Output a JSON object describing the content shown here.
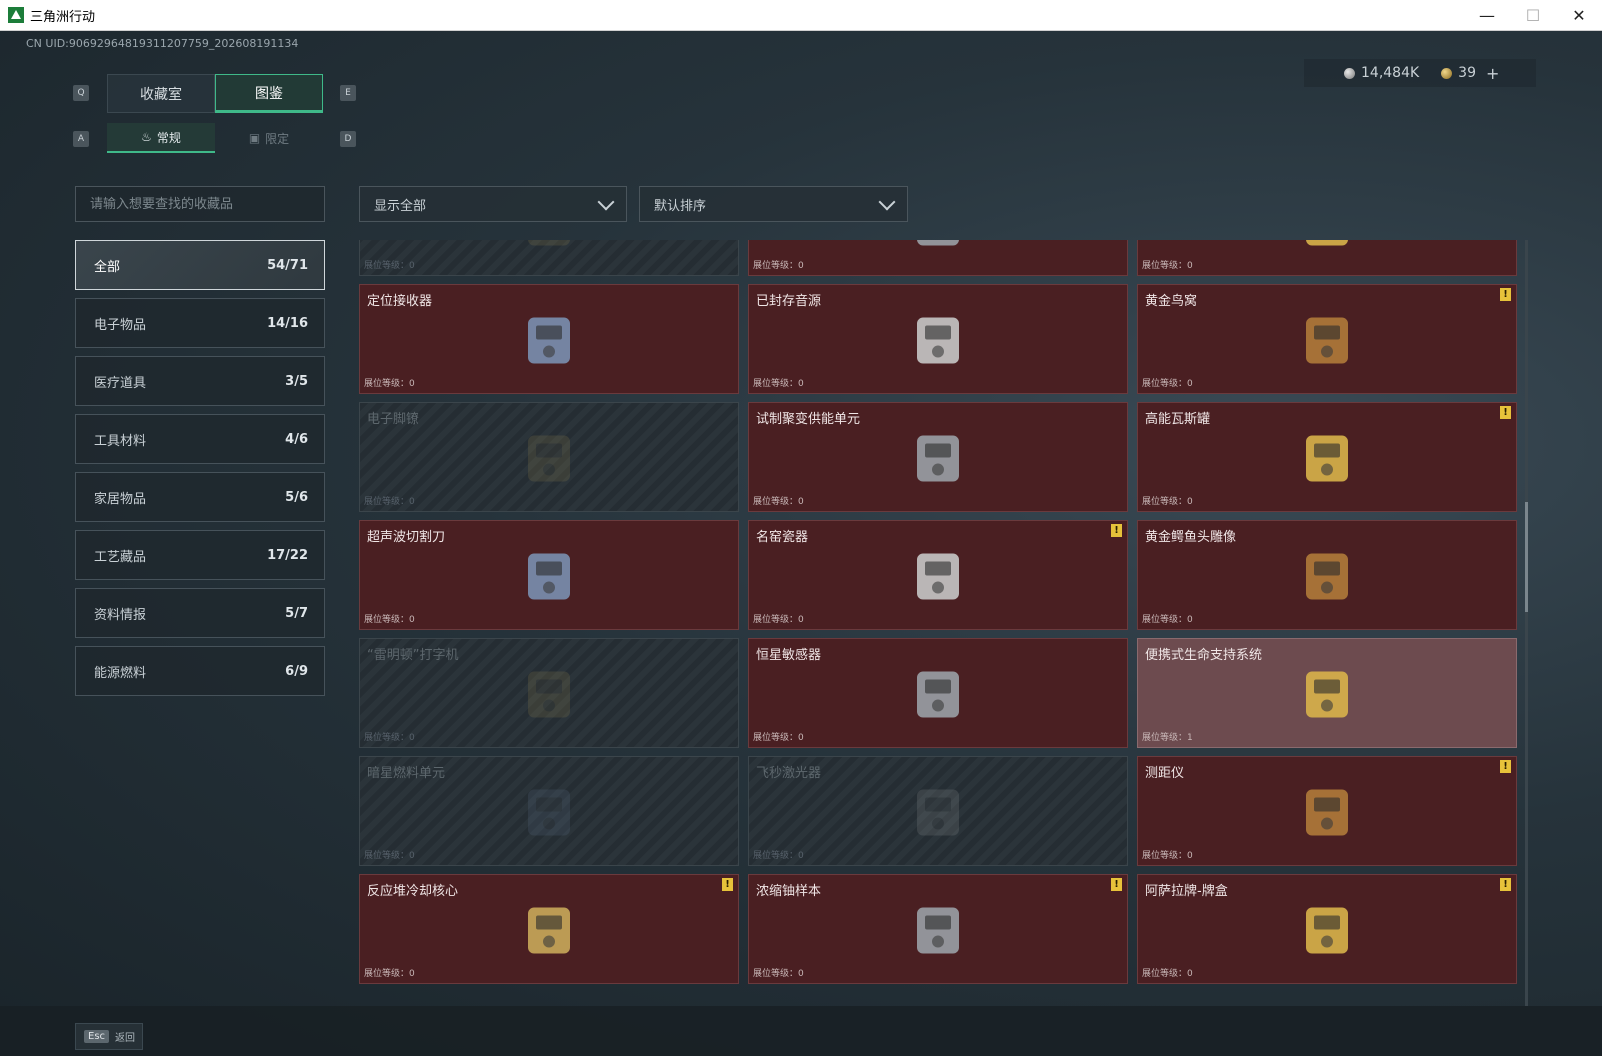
{
  "window": {
    "title": "三角洲行动"
  },
  "uid": "CN UID:9069296481931120775​9_202608191134",
  "main_tabs": [
    {
      "label": "收藏室",
      "active": false
    },
    {
      "label": "图鉴",
      "active": true
    }
  ],
  "sub_tabs": [
    {
      "label": "常规",
      "active": true
    },
    {
      "label": "限定",
      "active": false
    }
  ],
  "key_hints": {
    "prev_main": "Q",
    "next_main": "E",
    "prev_sub": "A",
    "next_sub": "D"
  },
  "currency": {
    "silver": "14,484K",
    "gold": "39",
    "add": "+"
  },
  "search": {
    "placeholder": "请输入想要查找的收藏品"
  },
  "filters": {
    "display": "显示全部",
    "sort": "默认排序"
  },
  "categories": [
    {
      "label": "全部",
      "count": "54/71",
      "active": true
    },
    {
      "label": "电子物品",
      "count": "14/16"
    },
    {
      "label": "医疗道具",
      "count": "3/5"
    },
    {
      "label": "工具材料",
      "count": "4/6"
    },
    {
      "label": "家居物品",
      "count": "5/6"
    },
    {
      "label": "工艺藏品",
      "count": "17/22"
    },
    {
      "label": "资料情报",
      "count": "5/7"
    },
    {
      "label": "能源燃料",
      "count": "6/9"
    }
  ],
  "level_label": "展位等级：",
  "items": [
    {
      "name": "",
      "level": "0",
      "state": "locked",
      "icon": "device-icon"
    },
    {
      "name": "",
      "level": "0",
      "state": "owned",
      "icon": "map-icon"
    },
    {
      "name": "",
      "level": "0",
      "state": "owned",
      "icon": "painting-icon"
    },
    {
      "name": "定位接收器",
      "level": "0",
      "state": "owned",
      "icon": "receiver-icon"
    },
    {
      "name": "已封存音源",
      "level": "0",
      "state": "owned",
      "icon": "reel-recorder-icon"
    },
    {
      "name": "黄金鸟窝",
      "level": "0",
      "state": "owned",
      "badge": "!",
      "icon": "golden-nest-icon"
    },
    {
      "name": "电子脚镣",
      "level": "0",
      "state": "locked",
      "icon": "ankle-monitor-icon"
    },
    {
      "name": "试制聚变供能单元",
      "level": "0",
      "state": "owned",
      "icon": "fusion-cell-icon"
    },
    {
      "name": "高能瓦斯罐",
      "level": "0",
      "state": "owned",
      "badge": "!",
      "icon": "gas-tank-icon"
    },
    {
      "name": "超声波切割刀",
      "level": "0",
      "state": "owned",
      "icon": "cutter-icon"
    },
    {
      "name": "名窑瓷器",
      "level": "0",
      "state": "owned",
      "badge": "!",
      "icon": "porcelain-icon"
    },
    {
      "name": "黄金鳄鱼头雕像",
      "level": "0",
      "state": "owned",
      "icon": "gold-croc-icon"
    },
    {
      "name": "“雷明顿”打字机",
      "level": "0",
      "state": "locked",
      "icon": "typewriter-icon"
    },
    {
      "name": "恒星敏感器",
      "level": "0",
      "state": "owned",
      "icon": "star-sensor-icon"
    },
    {
      "name": "便携式生命支持系统",
      "level": "1",
      "state": "owned-light",
      "icon": "life-support-icon"
    },
    {
      "name": "暗星燃料单元",
      "level": "0",
      "state": "locked",
      "icon": "fuel-cell-icon"
    },
    {
      "name": "飞秒激光器",
      "level": "0",
      "state": "locked",
      "icon": "laser-icon"
    },
    {
      "name": "测距仪",
      "level": "0",
      "state": "owned",
      "badge": "!",
      "icon": "rangefinder-icon"
    },
    {
      "name": "反应堆冷却核心",
      "level": "0",
      "state": "owned",
      "badge": "!",
      "icon": "reactor-core-icon"
    },
    {
      "name": "浓缩铀样本",
      "level": "0",
      "state": "owned",
      "badge": "!",
      "icon": "uranium-icon"
    },
    {
      "name": "阿萨拉牌-牌盒",
      "level": "0",
      "state": "owned",
      "badge": "!",
      "icon": "card-box-icon"
    }
  ],
  "footer": {
    "esc_key": "Esc",
    "back_label": "返回"
  },
  "colors": {
    "accent": "#3fb989",
    "card_owned": "#4a1f22",
    "badge": "#e7c23a"
  }
}
